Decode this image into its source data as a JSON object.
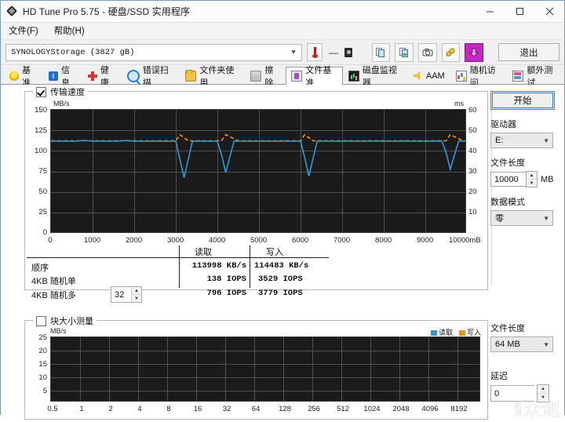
{
  "window": {
    "title": "HD Tune Pro 5.75 - 硬盘/SSD 实用程序",
    "icon": "diamond-logo-icon",
    "minimize": "–",
    "maximize": "□",
    "close": "✕"
  },
  "menu": {
    "items": [
      {
        "label": "文件(F)",
        "name": "menu-file"
      },
      {
        "label": "帮助(H)",
        "name": "menu-help"
      }
    ]
  },
  "toolbar": {
    "drive_value": "SYNOLOGYStorage (3827 gB)",
    "temperature_icon": "thermometer-icon",
    "temperature_value": "—",
    "disk_icon": "hdd-icon",
    "buttons": [
      {
        "name": "copy-icon",
        "label": "copy-icon"
      },
      {
        "name": "copy-image-icon",
        "label": "copy-image-icon"
      },
      {
        "name": "camera-icon",
        "label": "camera-icon"
      },
      {
        "name": "link-icon",
        "label": "link-icon"
      },
      {
        "name": "download-icon",
        "label": "download-icon"
      }
    ],
    "exit_label": "退出"
  },
  "tabs": [
    {
      "label": "基准",
      "icon": "bulb-icon",
      "active": false
    },
    {
      "label": "信息",
      "icon": "info-icon",
      "active": false
    },
    {
      "label": "健康",
      "icon": "health-cross-icon",
      "active": false
    },
    {
      "label": "错误扫描",
      "icon": "magnifier-icon",
      "active": false
    },
    {
      "label": "文件夹使用",
      "icon": "folder-icon",
      "active": false
    },
    {
      "label": "擦除",
      "icon": "bin-icon",
      "active": false
    },
    {
      "label": "文件基准",
      "icon": "file-benchmark-icon",
      "active": true
    },
    {
      "label": "磁盘监视器",
      "icon": "bar-chart-icon",
      "active": false
    },
    {
      "label": "AAM",
      "icon": "speaker-icon",
      "active": false
    },
    {
      "label": "随机访问",
      "icon": "random-access-icon",
      "active": false
    },
    {
      "label": "额外测试",
      "icon": "extra-tests-icon",
      "active": false
    }
  ],
  "transfer_panel": {
    "checkbox_label": "传输速度",
    "checkbox_checked": true,
    "left_unit": "MB/s",
    "right_unit": "ms"
  },
  "block_panel": {
    "checkbox_label": "块大小测量",
    "checkbox_checked": false,
    "left_unit": "MB/s",
    "legend": [
      {
        "label": "读取",
        "color": "#2e9bd6"
      },
      {
        "label": "写入",
        "color": "#e8921f"
      }
    ]
  },
  "results": {
    "col_read": "读取",
    "col_write": "写入",
    "rows": [
      {
        "label": "顺序",
        "read": "113998 KB/s",
        "write": "114483 KB/s",
        "spinner": null
      },
      {
        "label": "4KB 随机单",
        "read": "138 IOPS",
        "write": "3529 IOPS",
        "spinner": null
      },
      {
        "label": "4KB 随机多",
        "read": "796 IOPS",
        "write": "3779 IOPS",
        "spinner": "32"
      }
    ]
  },
  "side_top": {
    "start_label": "开始",
    "drive_label": "驱动器",
    "drive_value": "E:",
    "length_label": "文件长度",
    "length_value": "10000",
    "length_unit": "MB",
    "pattern_label": "数据模式",
    "pattern_value": "零"
  },
  "side_bottom": {
    "length_label": "文件长度",
    "length_value": "64 MB",
    "delay_label": "延迟",
    "delay_value": "0"
  },
  "watermark": {
    "small_top": "新",
    "small_bottom": "浪",
    "big": "众测"
  },
  "chart_data": [
    {
      "type": "line",
      "name": "transfer-rate-chart",
      "title": "传输速度",
      "xlabel": "",
      "ylabel": "MB/s",
      "y2label": "ms",
      "xlim": [
        0,
        10000
      ],
      "ylim": [
        0,
        150
      ],
      "y2lim": [
        0,
        60
      ],
      "grid": true,
      "xticks": [
        0,
        1000,
        2000,
        3000,
        4000,
        5000,
        6000,
        7000,
        8000,
        9000,
        10000
      ],
      "xtick_labels": [
        "0",
        "1000",
        "2000",
        "3000",
        "4000",
        "5000",
        "6000",
        "7000",
        "8000",
        "9000",
        "10000mB"
      ],
      "yticks": [
        0,
        25,
        50,
        75,
        100,
        125,
        150
      ],
      "y2ticks": [
        10,
        20,
        30,
        40,
        50,
        60
      ],
      "series": [
        {
          "name": "读取",
          "color": "#2e9bd6",
          "axis": "left",
          "x": [
            0,
            200,
            400,
            600,
            800,
            1000,
            1200,
            1400,
            1600,
            1800,
            2000,
            2200,
            2400,
            2600,
            2800,
            3000,
            3100,
            3200,
            3400,
            3600,
            3800,
            4000,
            4100,
            4200,
            4400,
            4600,
            4800,
            5000,
            5200,
            5400,
            5600,
            5800,
            6000,
            6100,
            6200,
            6400,
            6600,
            6800,
            7000,
            7200,
            7400,
            7600,
            7800,
            8000,
            8200,
            8400,
            8600,
            8800,
            9000,
            9200,
            9400,
            9500,
            9600,
            9800,
            10000
          ],
          "y": [
            112,
            112,
            112,
            112,
            113,
            112,
            112,
            112,
            112,
            113,
            112,
            112,
            112,
            112,
            112,
            112,
            90,
            68,
            112,
            112,
            112,
            112,
            96,
            74,
            112,
            112,
            112,
            112,
            112,
            112,
            112,
            112,
            112,
            92,
            70,
            112,
            112,
            112,
            112,
            112,
            112,
            112,
            112,
            112,
            112,
            112,
            112,
            112,
            112,
            112,
            112,
            98,
            78,
            112,
            112
          ]
        },
        {
          "name": "写入",
          "color": "#e8921f",
          "axis": "right",
          "x": [
            0,
            300,
            600,
            900,
            1200,
            1500,
            1800,
            2100,
            2400,
            2700,
            3000,
            3100,
            3300,
            3600,
            3900,
            4100,
            4200,
            4500,
            4800,
            5100,
            5400,
            5700,
            6000,
            6100,
            6300,
            6600,
            6900,
            7200,
            7500,
            7800,
            8100,
            8400,
            8700,
            9000,
            9300,
            9500,
            9600,
            9900,
            10000
          ],
          "y": [
            45,
            45,
            45,
            45,
            45,
            45,
            45,
            45,
            45,
            45,
            45,
            48,
            45,
            45,
            45,
            45,
            48,
            45,
            45,
            45,
            45,
            45,
            45,
            48,
            45,
            45,
            45,
            45,
            45,
            45,
            45,
            45,
            45,
            45,
            45,
            45,
            48,
            45,
            45
          ]
        }
      ]
    },
    {
      "type": "bar",
      "name": "block-size-chart",
      "title": "块大小测量",
      "xlabel": "",
      "ylabel": "MB/s",
      "ylim": [
        0,
        25
      ],
      "yticks": [
        5,
        10,
        15,
        20,
        25
      ],
      "grid": true,
      "categories": [
        "0.5",
        "1",
        "2",
        "4",
        "8",
        "16",
        "32",
        "64",
        "128",
        "256",
        "512",
        "1024",
        "2048",
        "4096",
        "8192"
      ],
      "series": [
        {
          "name": "读取",
          "color": "#2e9bd6",
          "values": [
            0,
            0,
            0,
            0,
            0,
            0,
            0,
            0,
            0,
            0,
            0,
            0,
            0,
            0,
            0
          ]
        },
        {
          "name": "写入",
          "color": "#e8921f",
          "values": [
            0,
            0,
            0,
            0,
            0,
            0,
            0,
            0,
            0,
            0,
            0,
            0,
            0,
            0,
            0
          ]
        }
      ]
    }
  ]
}
